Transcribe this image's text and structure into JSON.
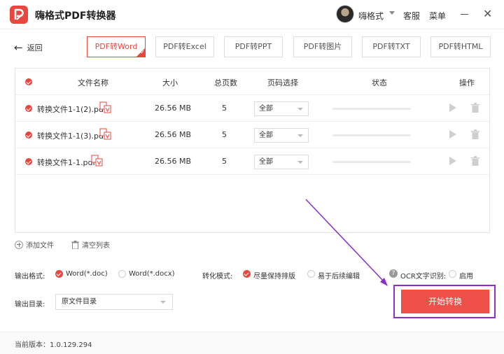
{
  "app": {
    "title": "嗨格式PDF转换器"
  },
  "header": {
    "username": "嗨格式",
    "service": "客服",
    "menu": "菜单",
    "minimize": "—",
    "close": "✕"
  },
  "nav": {
    "back_label": "返回"
  },
  "tabs": [
    {
      "label": "PDF转Word",
      "active": true
    },
    {
      "label": "PDF转Excel",
      "active": false
    },
    {
      "label": "PDF转PPT",
      "active": false
    },
    {
      "label": "PDF转图片",
      "active": false
    },
    {
      "label": "PDF转TXT",
      "active": false
    },
    {
      "label": "PDF转HTML",
      "active": false
    }
  ],
  "table": {
    "headers": {
      "name": "文件名称",
      "size": "大小",
      "pages": "总页数",
      "range": "页码选择",
      "status": "状态",
      "ops": "操作"
    },
    "rows": [
      {
        "name": "转换文件1-1(2).pdf",
        "size": "26.56 MB",
        "pages": "5",
        "range": "全部",
        "progress": 0
      },
      {
        "name": "转换文件1-1(3).pdf",
        "size": "26.56 MB",
        "pages": "5",
        "range": "全部",
        "progress": 0
      },
      {
        "name": "转换文件1-1.pdf",
        "size": "26.56 MB",
        "pages": "5",
        "range": "全部",
        "progress": 0
      }
    ]
  },
  "tools": {
    "add_file": "添加文件",
    "clear_list": "清空列表"
  },
  "options": {
    "output_format_label": "输出格式:",
    "format_doc": "Word(*.doc)",
    "format_docx": "Word(*.docx)",
    "mode_label": "转化模式:",
    "mode_keep_layout": "尽量保持排版",
    "mode_easy_edit": "易于后续编辑",
    "ocr_label": "OCR文字识别:",
    "ocr_enable": "启用",
    "output_dir_label": "输出目录:",
    "output_dir_value": "原文件目录"
  },
  "actions": {
    "start_label": "开始转换"
  },
  "footer": {
    "version": "当前版本：1.0.129.294"
  },
  "colors": {
    "accent": "#e8473f",
    "highlight": "#8b2fc9"
  }
}
